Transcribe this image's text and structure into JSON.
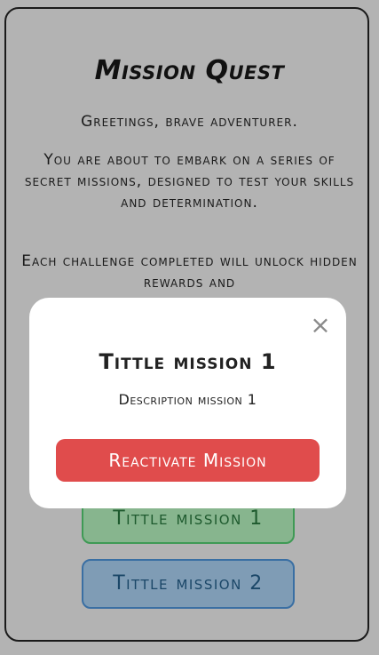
{
  "app": {
    "title": "Mission Quest"
  },
  "intro": {
    "greeting": "Greetings, brave adventurer.",
    "body": "You are about to embark on a series of secret missions, designed to test your skills and determination.",
    "challenge_partial": "Each challenge completed will unlock hidden rewards and"
  },
  "missions": [
    {
      "label": "Tittle mission 1",
      "color": "#87b58e",
      "border_color": "#3f9a55"
    },
    {
      "label": "Tittle mission 2",
      "color": "#7f9cb5",
      "border_color": "#3a6fa3"
    }
  ],
  "modal": {
    "close_glyph": "×",
    "title": "Tittle mission 1",
    "description": "Description mission 1",
    "action_label": "Reactivate Mission",
    "action_color": "#e04c4c"
  },
  "colors": {
    "overlay": "#b3b3b3",
    "modal_background": "#ffffff"
  }
}
